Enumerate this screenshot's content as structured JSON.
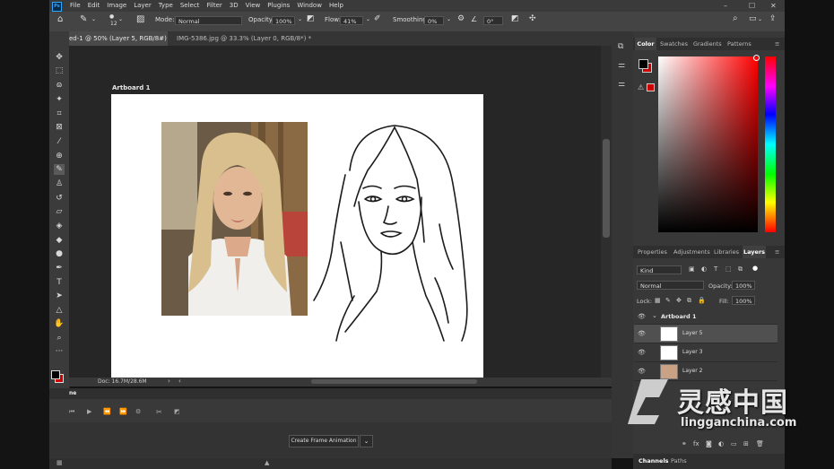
{
  "app": {
    "logo": "Ps"
  },
  "menu": [
    "File",
    "Edit",
    "Image",
    "Layer",
    "Type",
    "Select",
    "Filter",
    "3D",
    "View",
    "Plugins",
    "Window",
    "Help"
  ],
  "options": {
    "brush_size": "12",
    "mode_label": "Mode:",
    "mode_value": "Normal",
    "opacity_label": "Opacity:",
    "opacity_value": "100%",
    "flow_label": "Flow:",
    "flow_value": "41%",
    "smoothing_label": "Smoothing:",
    "smoothing_value": "0%",
    "angle_value": "0°"
  },
  "tabs": [
    {
      "label": "ed-1 @ 50% (Layer 5, RGB/8#) *",
      "close": "×"
    },
    {
      "label": "IMG-5386.jpg @ 33.3% (Layer 0, RGB/8*) *",
      "close": "×"
    }
  ],
  "canvas": {
    "artboard_label": "Artboard 1"
  },
  "status": {
    "doc": "Doc: 16.7M/28.6M"
  },
  "timeline": {
    "tab_label": "ne",
    "create_button": "Create Frame Animation"
  },
  "color_panel": {
    "tabs": [
      "Color",
      "Swatches",
      "Gradients",
      "Patterns"
    ],
    "fg": "#000000",
    "bg": "#cc0000"
  },
  "layers_panel": {
    "tabs": [
      "Properties",
      "Adjustments",
      "Libraries",
      "Layers"
    ],
    "filter_kind": "Kind",
    "blend_mode": "Normal",
    "opacity_label": "Opacity:",
    "opacity_value": "100%",
    "lock_label": "Lock:",
    "fill_label": "Fill:",
    "fill_value": "100%",
    "group": "Artboard 1",
    "layers": [
      "Layer 5",
      "Layer 3",
      "Layer 2"
    ]
  },
  "bottom_tabs": [
    "Channels",
    "Paths"
  ],
  "watermark": {
    "cn": "灵感中国",
    "url": "lingganchina.com"
  },
  "colors": {
    "accent": "#31a8ff",
    "panel": "#383838",
    "canvas": "#262626"
  }
}
